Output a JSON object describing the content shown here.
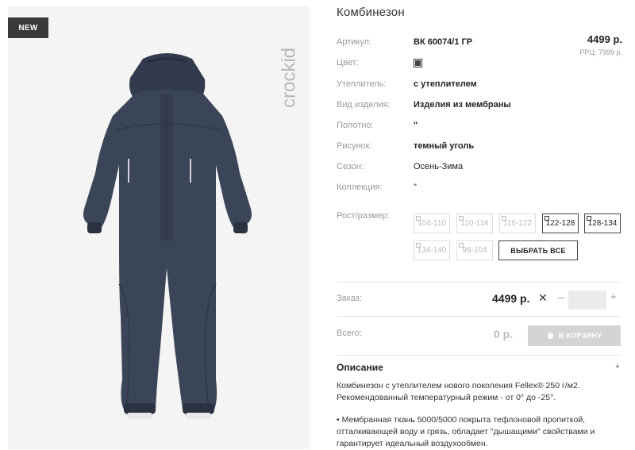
{
  "product": {
    "badge": "NEW",
    "title": "Комбинезон",
    "brand_logo": "crockid"
  },
  "price": {
    "current": "4499 р.",
    "rrp": "РРЦ: 7999 р."
  },
  "specs": [
    {
      "label": "Артикул:",
      "value": "ВК 60074/1 ГР"
    },
    {
      "label": "Цвет:",
      "value": ""
    },
    {
      "label": "Утеплитель:",
      "value": "с утеплителем"
    },
    {
      "label": "Вид изделия:",
      "value": "Изделия из мембраны"
    },
    {
      "label": "Полотно:",
      "value": "\""
    },
    {
      "label": "Рисунок:",
      "value": "темный уголь"
    },
    {
      "label": "Сезон:",
      "value": "Осень-Зима"
    },
    {
      "label": "Коллекция:",
      "value": "\""
    }
  ],
  "swatch_color": "#444444",
  "sizes": {
    "label": "Рост/размер:",
    "items": [
      {
        "label": "104-110",
        "available": false
      },
      {
        "label": "110-116",
        "available": false
      },
      {
        "label": "116-122",
        "available": false
      },
      {
        "label": "122-128",
        "available": true
      },
      {
        "label": "128-134",
        "available": true
      },
      {
        "label": "134-140",
        "available": false
      },
      {
        "label": "98-104",
        "available": false
      }
    ],
    "select_all": "ВЫБРАТЬ ВСЕ"
  },
  "order": {
    "label": "Заказ:",
    "price": "4499 р.",
    "times": "✕",
    "minus": "–",
    "plus": "+"
  },
  "total": {
    "label": "Всего:",
    "value": "0 р.",
    "cart_button": "В КОРЗИНУ"
  },
  "description": {
    "heading": "Описание",
    "lines": [
      "Комбинезон с утеплителем нового поколения Fellex® 250 г/м2.",
      "Рекомендованный температурный режим - от 0° до -25°.",
      "• Мембранная ткань 5000/5000 покрыта тефлоновой пропиткой,",
      "отталкивающей воду и грязь, обладает \"дышащими\" свойствами и",
      "гарантирует идеальный воздухообмен."
    ]
  },
  "colors": {
    "accent": "#3a3a3a",
    "suit": "#3b4558",
    "cart_button": "#d4d4d4"
  }
}
